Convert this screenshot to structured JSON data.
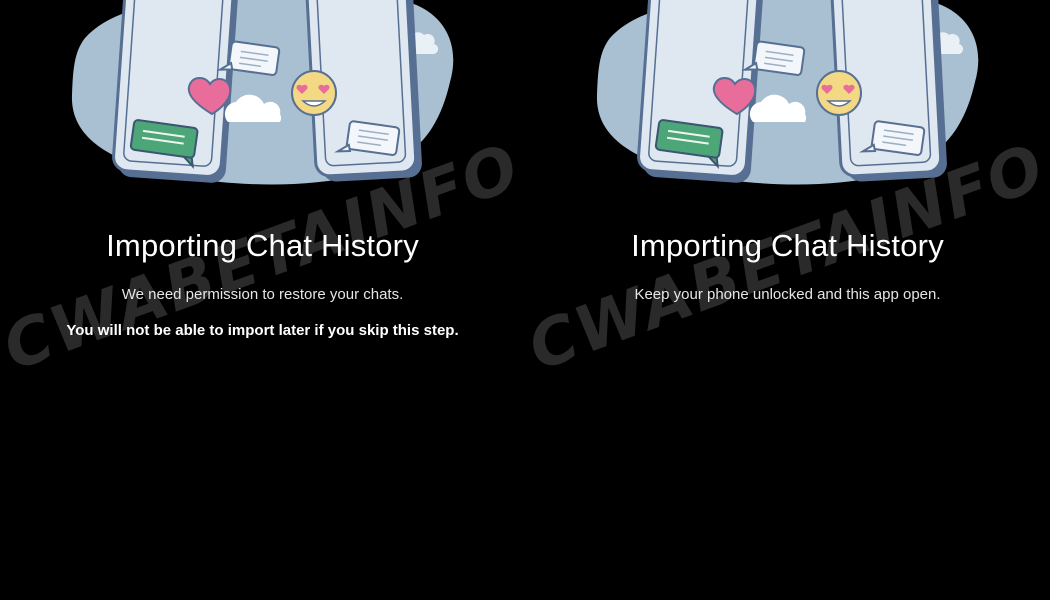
{
  "colors": {
    "background": "#000000",
    "blob": "#a9bfd2",
    "phone_fill": "#dfe8f1",
    "phone_stroke": "#566f92",
    "heart": "#e86d9b",
    "emoji": "#f3d983",
    "green_bubble": "#4da678",
    "cloud": "#ffffff"
  },
  "watermark": "CWABETAINFO",
  "screens": [
    {
      "title": "Importing Chat History",
      "subtitle": "We need permission to restore your chats.",
      "warning": "You will not be able to import later if you skip this step."
    },
    {
      "title": "Importing Chat History",
      "subtitle": "Keep your phone unlocked and this app open."
    }
  ],
  "icons": [
    "chat-bubble-icon",
    "heart-icon",
    "heart-eyes-emoji-icon",
    "cloud-icon",
    "phone-icon"
  ]
}
